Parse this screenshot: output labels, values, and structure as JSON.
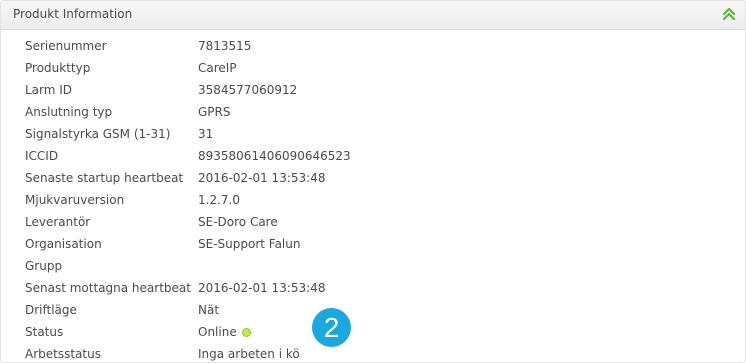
{
  "panel": {
    "title": "Produkt Information",
    "collapse_icon": "double-chevron-up-icon"
  },
  "rows": [
    {
      "label": "Serienummer",
      "value": "7813515"
    },
    {
      "label": "Produkttyp",
      "value": "CareIP"
    },
    {
      "label": "Larm ID",
      "value": "3584577060912"
    },
    {
      "label": "Anslutning typ",
      "value": "GPRS"
    },
    {
      "label": "Signalstyrka GSM (1-31)",
      "value": "31"
    },
    {
      "label": "ICCID",
      "value": "89358061406090646523"
    },
    {
      "label": "Senaste startup heartbeat",
      "value": "2016-02-01 13:53:48"
    },
    {
      "label": "Mjukvaruversion",
      "value": "1.2.7.0"
    },
    {
      "label": "Leverantör",
      "value": "SE-Doro Care"
    },
    {
      "label": "Organisation",
      "value": "SE-Support Falun"
    },
    {
      "label": "Grupp",
      "value": ""
    },
    {
      "label": "Senast mottagna heartbeat",
      "value": "2016-02-01 13:53:48"
    },
    {
      "label": "Driftläge",
      "value": "Nät"
    },
    {
      "label": "Status",
      "value": "Online"
    },
    {
      "label": "Arbetsstatus",
      "value": "Inga arbeten i kö"
    }
  ],
  "status_indicator": {
    "icon": "status-dot-icon",
    "color": "#c8e64b",
    "border_color": "#8cc63f"
  },
  "callout": {
    "number": "2",
    "color": "#1ba7e0"
  },
  "colors": {
    "header_bg": "#efefef",
    "text": "#4a4a4a",
    "chevron": "#5cb82e"
  }
}
